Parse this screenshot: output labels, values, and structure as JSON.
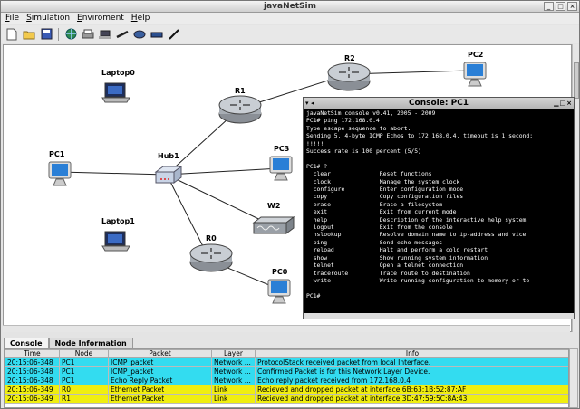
{
  "window": {
    "title": "javaNetSim"
  },
  "menu": [
    {
      "label": "File",
      "mnemonic": "F",
      "rest": "ile"
    },
    {
      "label": "Simulation",
      "mnemonic": "S",
      "rest": "imulation"
    },
    {
      "label": "Enviroment",
      "mnemonic": "E",
      "rest": "nviroment"
    },
    {
      "label": "Help",
      "mnemonic": "H",
      "rest": "elp"
    }
  ],
  "toolbar_icons": [
    "new-file-icon",
    "open-folder-icon",
    "save-disk-icon",
    "globe-icon",
    "printer-icon",
    "laptop-add-icon",
    "cable-icon",
    "router-add-icon",
    "switch-add-icon",
    "pen-icon"
  ],
  "devices": {
    "laptop0": "Laptop0",
    "laptop1": "Laptop1",
    "pc1": "PC1",
    "hub1": "Hub1",
    "r1": "R1",
    "r2": "R2",
    "pc2": "PC2",
    "pc3": "PC3",
    "w2": "W2",
    "r0": "R0",
    "pc0": "PC0"
  },
  "console": {
    "title": "Console: PC1",
    "lines": [
      "javaNetSim console v0.41, 2005 - 2009",
      "PC1# ping 172.168.0.4",
      "Type escape sequence to abort.",
      "Sending 5, 4-byte ICMP Echos to 172.168.0.4, timeout is 1 second:",
      "!!!!!",
      "Success rate is 100 percent (5/5)",
      "",
      "PC1# ?",
      "  clear              Reset functions",
      "  clock              Manage the system clock",
      "  configure          Enter configuration mode",
      "  copy               Copy configuration files",
      "  erase              Erase a filesystem",
      "  exit               Exit from current mode",
      "  help               Description of the interactive help system",
      "  logout             Exit from the console",
      "  nslookup           Resolve domain name to ip-address and vice",
      "  ping               Send echo messages",
      "  reload             Halt and perform a cold restart",
      "  show               Show running system information",
      "  telnet             Open a telnet connection",
      "  traceroute         Trace route to destination",
      "  write              Write running configuration to memory or te",
      "",
      "PC1#"
    ]
  },
  "tabs": [
    {
      "label": "Console",
      "active": true
    },
    {
      "label": "Node Information",
      "active": false
    }
  ],
  "log": {
    "columns": [
      "Time",
      "Node",
      "Packet",
      "Layer",
      "Info"
    ],
    "rows": [
      {
        "time": "20:15:06-348",
        "node": "PC1",
        "packet": "ICMP_packet",
        "layer": "Network ...",
        "info": "ProtocolStack received packet from local Interface.",
        "color": "#33dcf0"
      },
      {
        "time": "20:15:06-348",
        "node": "PC1",
        "packet": "ICMP_packet",
        "layer": "Network ...",
        "info": "Confirmed Packet is for this Network Layer Device.",
        "color": "#33dcf0"
      },
      {
        "time": "20:15:06-348",
        "node": "PC1",
        "packet": "Echo Reply Packet",
        "layer": "Network ...",
        "info": "Echo reply packet received from 172.168.0.4",
        "color": "#33dcf0"
      },
      {
        "time": "20:15:06-349",
        "node": "R0",
        "packet": "Ethernet Packet",
        "layer": "Link",
        "info": "Recieved and dropped packet at interface 6B:63:1B:52:87:AF",
        "color": "#f0ee10"
      },
      {
        "time": "20:15:06-349",
        "node": "R1",
        "packet": "Ethernet Packet",
        "layer": "Link",
        "info": "Recieved and dropped packet at interface 3D:47:59:5C:8A:43",
        "color": "#f0ee10"
      }
    ]
  },
  "colors": {
    "cyan_row": "#33dcf0",
    "yellow_row": "#f0ee10",
    "console_bg": "#000000"
  }
}
